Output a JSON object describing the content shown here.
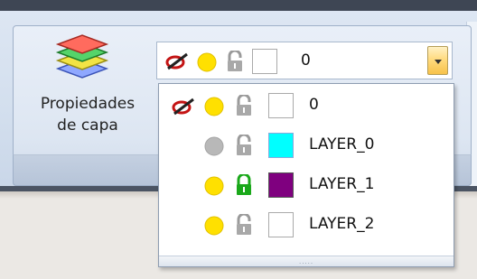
{
  "ribbon": {
    "button_label_line1": "Propiedades",
    "button_label_line2": "de capa"
  },
  "layer_combo": {
    "selected": {
      "name": "0",
      "on": true,
      "locked": false,
      "color": "#ffffff",
      "current_marker": true
    },
    "options": [
      {
        "name": "0",
        "on": true,
        "locked": false,
        "color": "#ffffff",
        "current_marker": true
      },
      {
        "name": "LAYER_0",
        "on": false,
        "locked": false,
        "color": "#00ffff",
        "current_marker": false
      },
      {
        "name": "LAYER_1",
        "on": true,
        "locked": true,
        "color": "#7f007f",
        "current_marker": false
      },
      {
        "name": "LAYER_2",
        "on": true,
        "locked": false,
        "color": "#ffffff",
        "current_marker": false
      }
    ],
    "grip": "....."
  },
  "colors": {
    "bulb_on": "#ffe000",
    "bulb_off": "#b8b8b8",
    "lock_open": "#9a9a9a",
    "lock_closed": "#1aa81a"
  }
}
